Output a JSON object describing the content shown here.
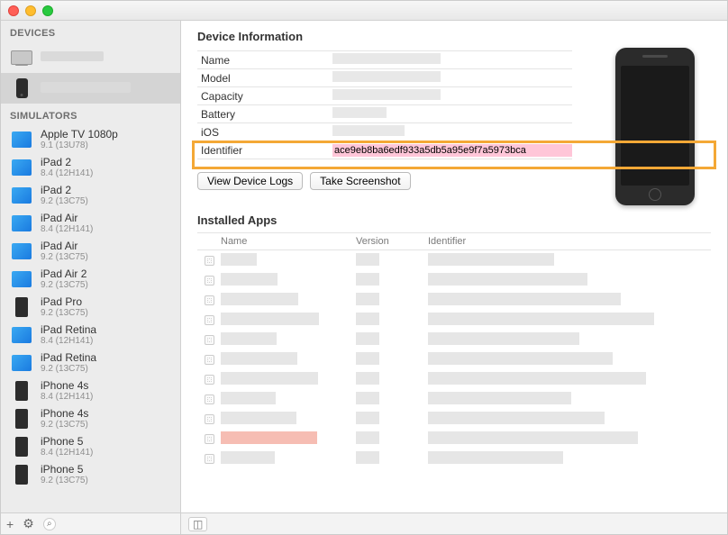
{
  "sidebar": {
    "devices_header": "DEVICES",
    "simulators_header": "SIMULATORS",
    "devices": [
      {
        "name": "",
        "sub": ""
      },
      {
        "name": "",
        "sub": ""
      }
    ],
    "simulators": [
      {
        "name": "Apple TV 1080p",
        "sub": "9.1 (13U78)",
        "type": "blue"
      },
      {
        "name": "iPad 2",
        "sub": "8.4 (12H141)",
        "type": "blue"
      },
      {
        "name": "iPad 2",
        "sub": "9.2 (13C75)",
        "type": "blue"
      },
      {
        "name": "iPad Air",
        "sub": "8.4 (12H141)",
        "type": "blue"
      },
      {
        "name": "iPad Air",
        "sub": "9.2 (13C75)",
        "type": "blue"
      },
      {
        "name": "iPad Air 2",
        "sub": "9.2 (13C75)",
        "type": "blue"
      },
      {
        "name": "iPad Pro",
        "sub": "9.2 (13C75)",
        "type": "black"
      },
      {
        "name": "iPad Retina",
        "sub": "8.4 (12H141)",
        "type": "blue"
      },
      {
        "name": "iPad Retina",
        "sub": "9.2 (13C75)",
        "type": "blue"
      },
      {
        "name": "iPhone 4s",
        "sub": "8.4 (12H141)",
        "type": "black"
      },
      {
        "name": "iPhone 4s",
        "sub": "9.2 (13C75)",
        "type": "black"
      },
      {
        "name": "iPhone 5",
        "sub": "8.4 (12H141)",
        "type": "black"
      },
      {
        "name": "iPhone 5",
        "sub": "9.2 (13C75)",
        "type": "black"
      }
    ]
  },
  "info": {
    "section_title": "Device Information",
    "rows": {
      "name": "Name",
      "model": "Model",
      "capacity": "Capacity",
      "battery": "Battery",
      "ios": "iOS",
      "identifier": "Identifier"
    },
    "identifier_value": "ace9eb8ba6edf933a5db5a95e9f7a5973bca",
    "btn_logs": "View Device Logs",
    "btn_screenshot": "Take Screenshot"
  },
  "apps": {
    "section_title": "Installed Apps",
    "headers": {
      "name": "Name",
      "version": "Version",
      "identifier": "Identifier"
    },
    "rows": 11
  }
}
